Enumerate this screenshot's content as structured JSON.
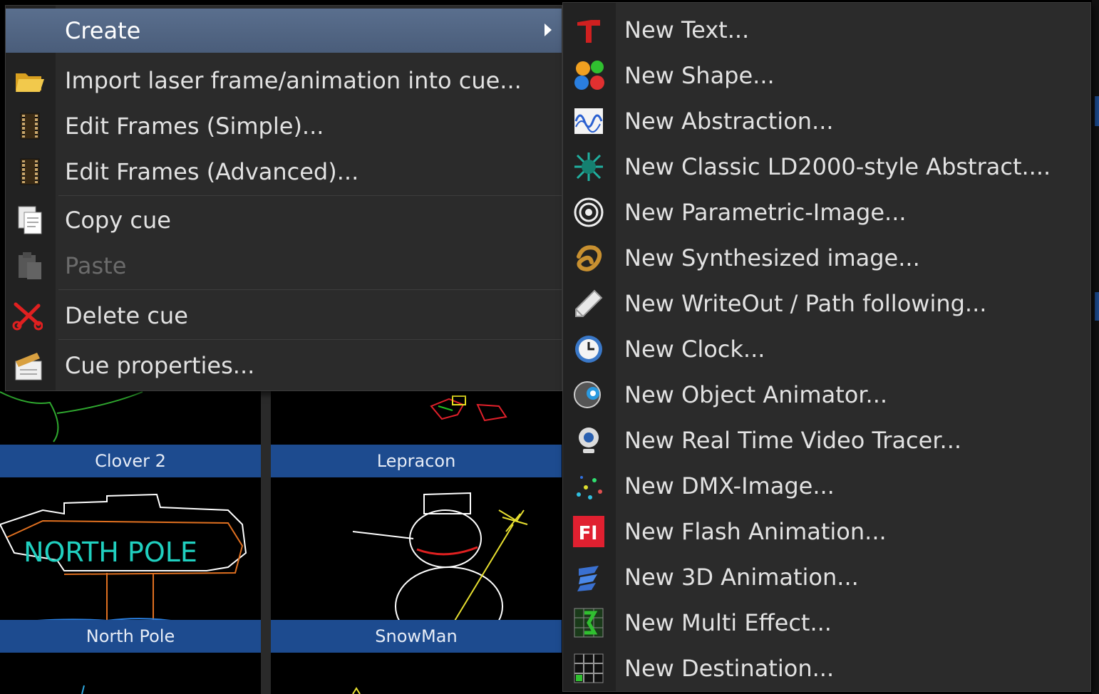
{
  "context_menu": {
    "items": [
      {
        "label": "Create",
        "icon": "none",
        "state": "highlighted",
        "has_submenu": true
      },
      {
        "label": "Import laser frame/animation into cue...",
        "icon": "open-folder-icon",
        "state": "normal"
      },
      {
        "label": "Edit Frames (Simple)...",
        "icon": "film-strip-icon",
        "state": "normal"
      },
      {
        "label": "Edit Frames (Advanced)...",
        "icon": "film-strip-icon",
        "state": "normal"
      },
      {
        "label": "Copy cue",
        "icon": "copy-icon",
        "state": "normal"
      },
      {
        "label": "Paste",
        "icon": "paste-icon",
        "state": "disabled"
      },
      {
        "label": "Delete cue",
        "icon": "scissors-icon",
        "state": "normal"
      },
      {
        "label": "Cue properties...",
        "icon": "clapperboard-icon",
        "state": "normal"
      }
    ]
  },
  "create_submenu": {
    "items": [
      {
        "label": "New Text...",
        "icon": "text-icon"
      },
      {
        "label": "New Shape...",
        "icon": "shape-icon"
      },
      {
        "label": "New Abstraction...",
        "icon": "abstraction-icon"
      },
      {
        "label": "New Classic LD2000-style Abstract....",
        "icon": "classic-abstract-icon"
      },
      {
        "label": "New Parametric-Image...",
        "icon": "parametric-icon"
      },
      {
        "label": "New Synthesized image...",
        "icon": "synthesized-icon"
      },
      {
        "label": "New WriteOut / Path following...",
        "icon": "pencil-icon"
      },
      {
        "label": "New Clock...",
        "icon": "clock-icon"
      },
      {
        "label": "New Object Animator...",
        "icon": "object-animator-icon"
      },
      {
        "label": "New Real Time Video Tracer...",
        "icon": "webcam-icon"
      },
      {
        "label": "New DMX-Image...",
        "icon": "dmx-icon"
      },
      {
        "label": "New Flash Animation...",
        "icon": "flash-icon"
      },
      {
        "label": "New 3D Animation...",
        "icon": "3d-animation-icon"
      },
      {
        "label": "New Multi Effect...",
        "icon": "multi-effect-icon"
      },
      {
        "label": "New Destination...",
        "icon": "destination-icon"
      }
    ]
  },
  "cue_grid": {
    "cues": [
      {
        "label": "Clover 2"
      },
      {
        "label": "Lepracon"
      },
      {
        "label": "North Pole",
        "art_text": "NORTH POLE"
      },
      {
        "label": "SnowMan"
      }
    ]
  },
  "colors": {
    "menu_bg": "#2b2b2b",
    "highlight": "#4f6482",
    "cue_label_bar": "#1d4b8f",
    "disabled_text": "#6b6b6b"
  }
}
